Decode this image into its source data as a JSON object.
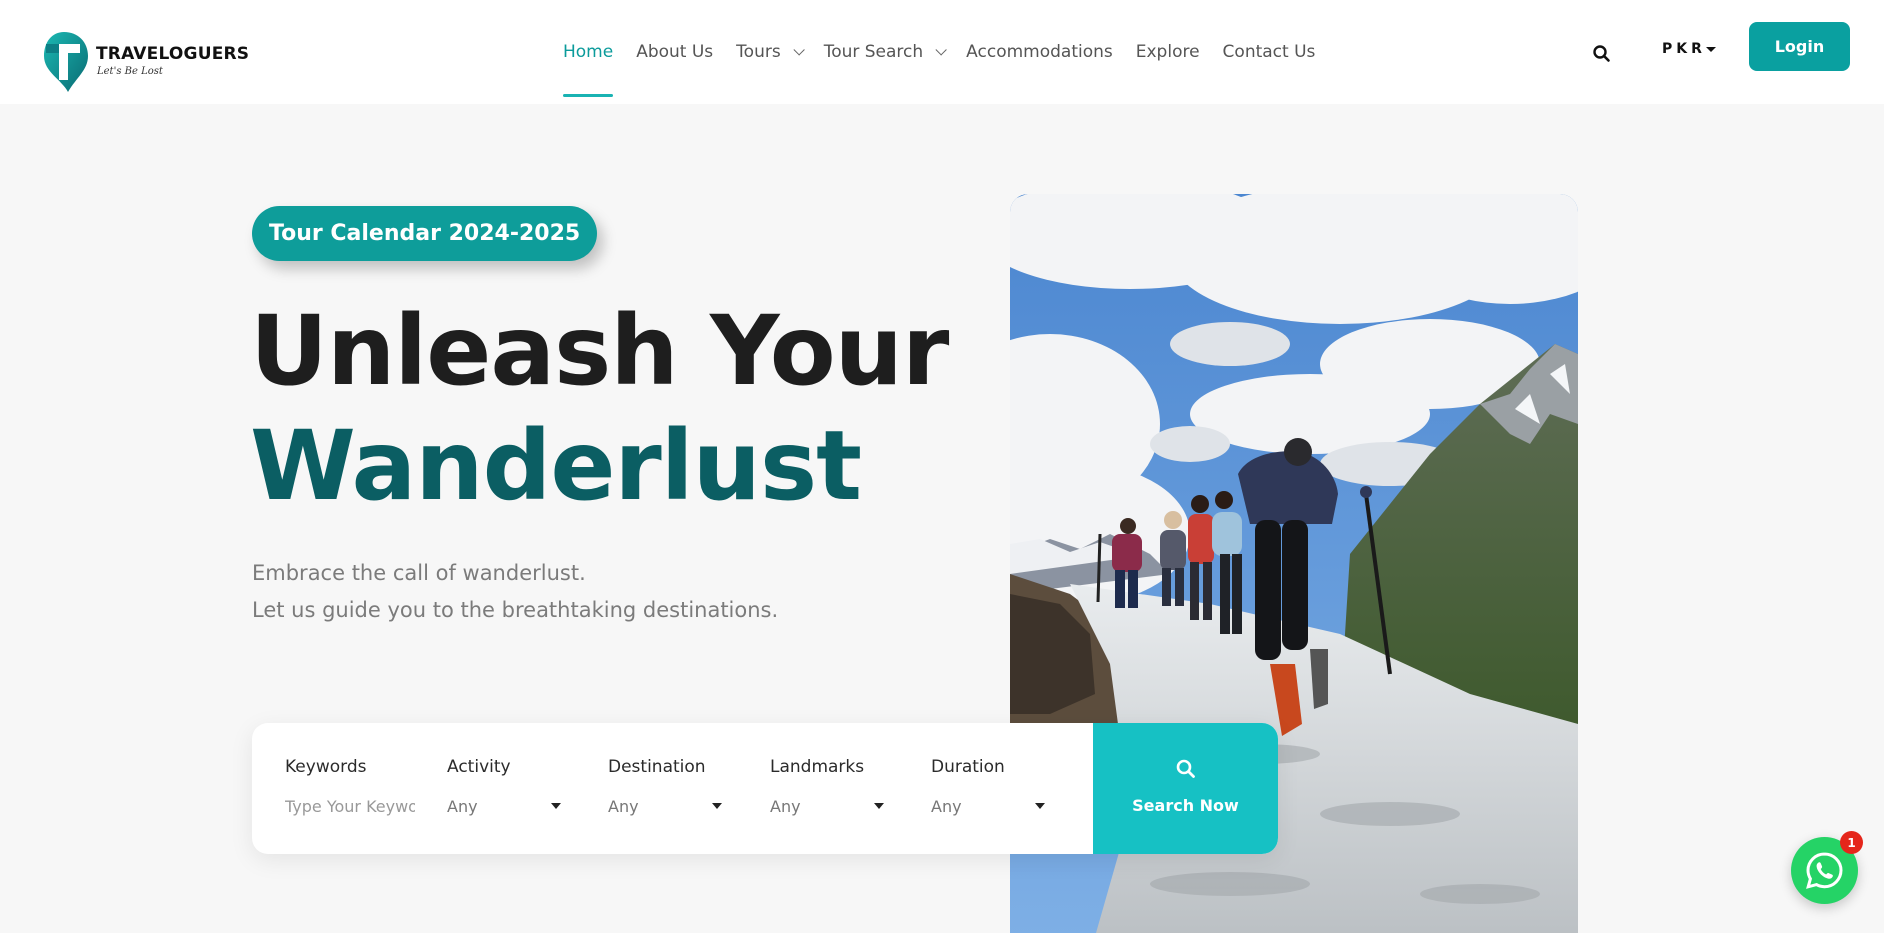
{
  "brand": {
    "name": "TRAVELOGUERS",
    "tagline": "Let's Be Lost",
    "accent_color": "#0aa0a0",
    "dark_teal": "#0b5e63"
  },
  "nav": {
    "items": [
      {
        "label": "Home",
        "active": true
      },
      {
        "label": "About Us"
      },
      {
        "label": "Tours",
        "dropdown": true
      },
      {
        "label": "Tour Search",
        "dropdown": true
      },
      {
        "label": "Accommodations"
      },
      {
        "label": "Explore"
      },
      {
        "label": "Contact Us"
      }
    ],
    "search_icon": "search-icon",
    "currency": "PKR",
    "login_label": "Login"
  },
  "hero": {
    "badge": "Tour Calendar 2024-2025",
    "title_line1": "Unleash Your",
    "title_line2": "Wanderlust",
    "subtitle_line1": "Embrace the call of wanderlust.",
    "subtitle_line2": "Let us guide you to the breathtaking destinations."
  },
  "search": {
    "keywords_label": "Keywords",
    "keywords_placeholder": "Type Your Keywords",
    "activity_label": "Activity",
    "activity_value": "Any",
    "destination_label": "Destination",
    "destination_value": "Any",
    "landmarks_label": "Landmarks",
    "landmarks_value": "Any",
    "duration_label": "Duration",
    "duration_value": "Any",
    "submit_label": "Search Now"
  },
  "whatsapp": {
    "icon": "whatsapp-icon",
    "badge_count": "1"
  }
}
